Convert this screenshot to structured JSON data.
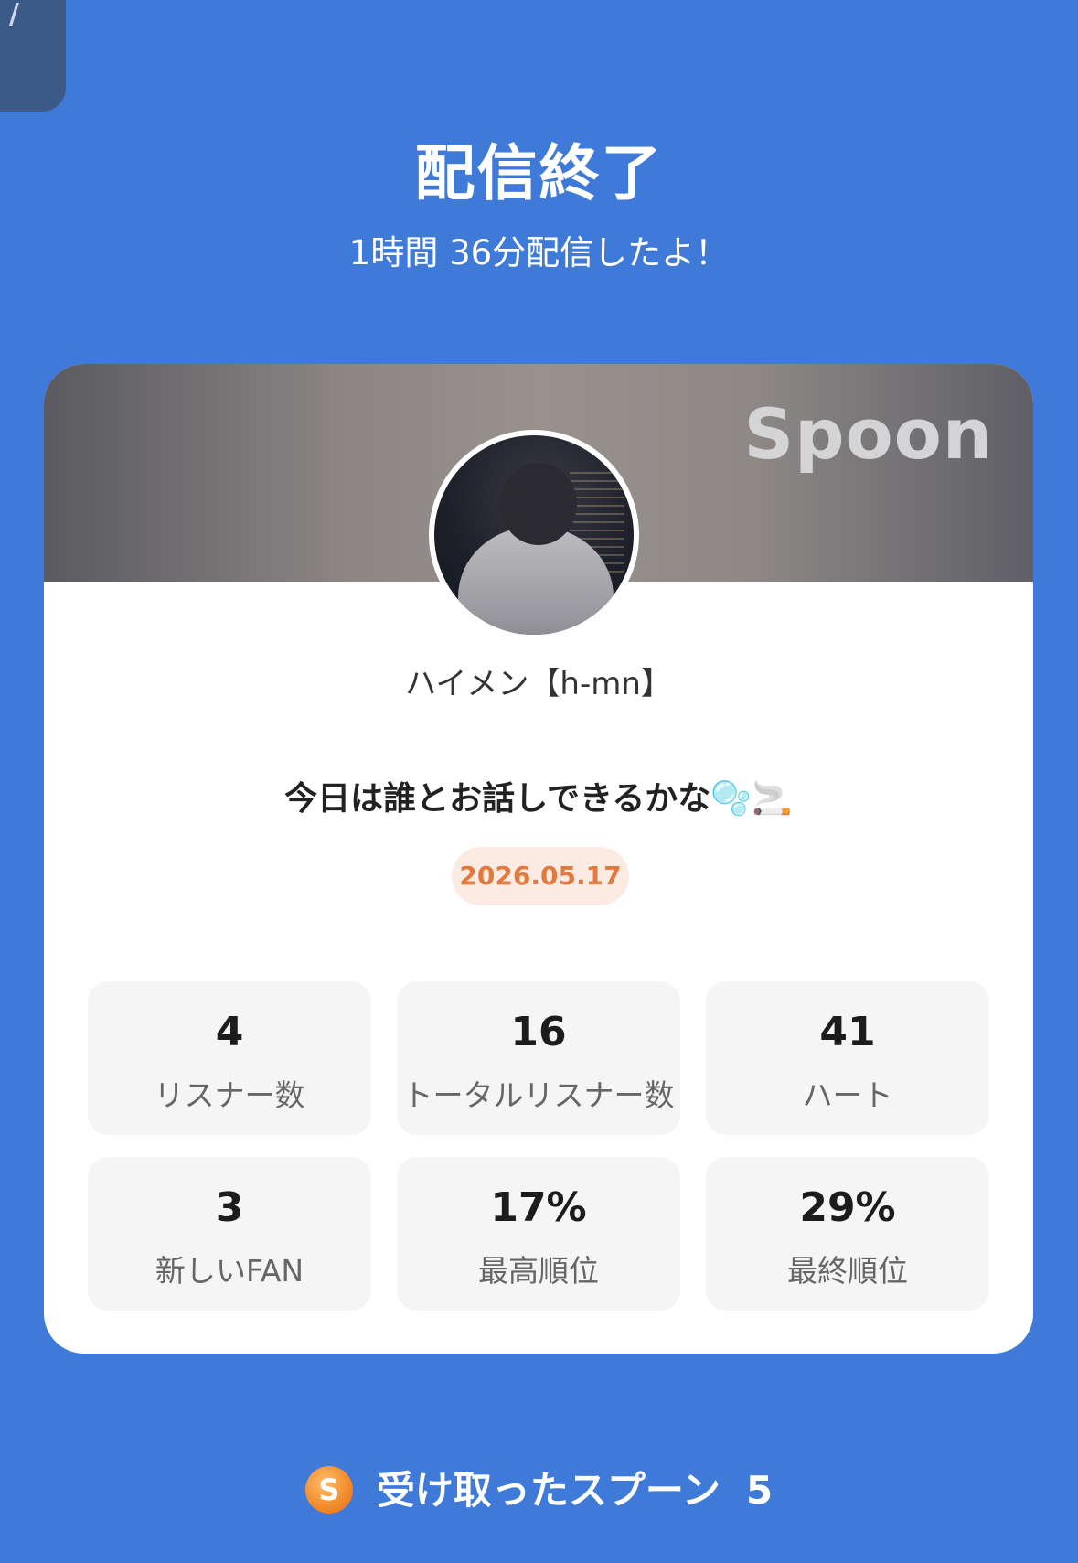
{
  "header": {
    "title": "配信終了",
    "subtitle": "1時間 36分配信したよ！"
  },
  "card": {
    "logo": "Spoon",
    "username": "ハイメン【h-mn】",
    "live_title": "今日は誰とお話しできるかな",
    "live_title_emoji": "🫧🚬",
    "date": "2026.05.17"
  },
  "stats": [
    {
      "value": "4",
      "label": "リスナー数"
    },
    {
      "value": "16",
      "label": "トータルリスナー数"
    },
    {
      "value": "41",
      "label": "ハート"
    },
    {
      "value": "3",
      "label": "新しいFAN"
    },
    {
      "value": "17%",
      "label": "最高順位"
    },
    {
      "value": "29%",
      "label": "最終順位"
    }
  ],
  "footer": {
    "coin_symbol": "S",
    "received_label": "受け取ったスプーン",
    "received_count": "5"
  },
  "colors": {
    "background": "#3f7ad9",
    "date_badge_bg": "#fcebe3",
    "date_badge_text": "#e27a3f",
    "coin": "#f28a2a"
  }
}
